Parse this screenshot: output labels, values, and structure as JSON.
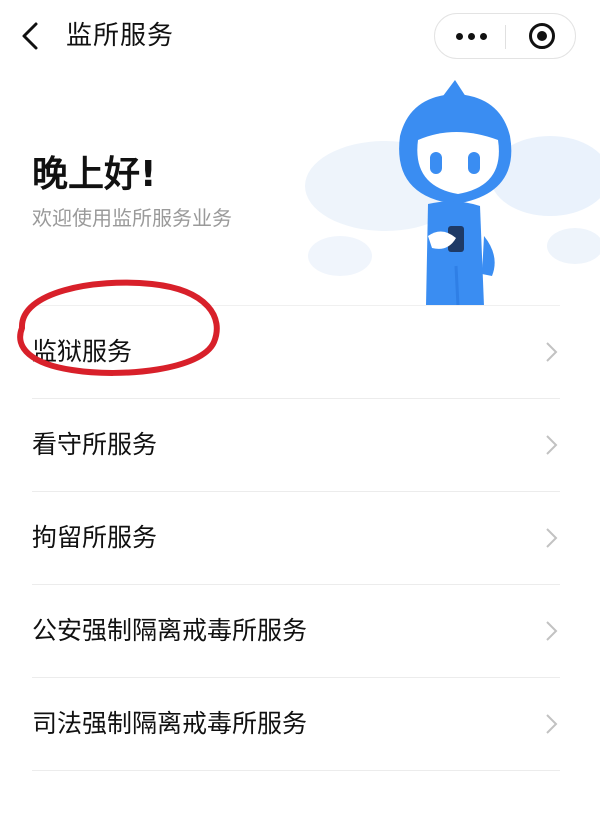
{
  "header": {
    "title": "监所服务",
    "back_icon": "chevron-left-icon",
    "more_icon": "more-dots-icon",
    "close_icon": "target-close-icon"
  },
  "hero": {
    "greeting": "晚上好!",
    "subtitle": "欢迎使用监所服务业务",
    "mascot_icon": "mascot-illustration"
  },
  "menu": {
    "items": [
      {
        "label": "监狱服务"
      },
      {
        "label": "看守所服务"
      },
      {
        "label": "拘留所服务"
      },
      {
        "label": "公安强制隔离戒毒所服务"
      },
      {
        "label": "司法强制隔离戒毒所服务"
      }
    ],
    "chevron_icon": "chevron-right-icon"
  },
  "annotation": {
    "highlighted_item": "监狱服务",
    "mark": "red-ellipse-annotation"
  },
  "colors": {
    "mascot_blue": "#3a8df2",
    "annotation_red": "#d8202a",
    "subtitle_gray": "#9a9a9a",
    "divider": "#ececec"
  }
}
